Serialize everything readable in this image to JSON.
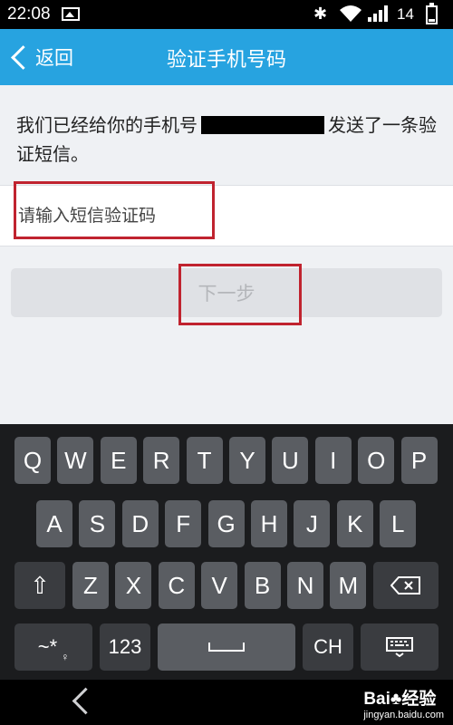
{
  "status_bar": {
    "time": "22:08",
    "battery_level": "14",
    "icons": [
      "image-icon",
      "bluetooth-icon",
      "wifi-icon",
      "signal-icon",
      "battery-icon"
    ]
  },
  "header": {
    "back_label": "返回",
    "title": "验证手机号码"
  },
  "form": {
    "notice_part1": "我们已经给你的手机号",
    "notice_part2": "发送了一条验证短信。",
    "code_placeholder": "请输入短信验证码",
    "code_value": "",
    "next_label": "下一步"
  },
  "keyboard": {
    "row1": [
      "Q",
      "W",
      "E",
      "R",
      "T",
      "Y",
      "U",
      "I",
      "O",
      "P"
    ],
    "row2": [
      "A",
      "S",
      "D",
      "F",
      "G",
      "H",
      "J",
      "K",
      "L"
    ],
    "row3": [
      "Z",
      "X",
      "C",
      "V",
      "B",
      "N",
      "M"
    ],
    "shift_icon": "⇧",
    "symbols_label": "~*",
    "mic_label": "♀",
    "numbers_label": "123",
    "lang_label": "CH",
    "backspace_icon": "backspace-icon",
    "keyboard_hide_icon": "keyboard-icon"
  },
  "watermark": {
    "brand": "Bai♣经验",
    "site": "jingyan.baidu.com"
  },
  "colors": {
    "header_bg": "#27a3e0",
    "highlight": "#c0232f",
    "key_bg": "#5a5d62"
  }
}
